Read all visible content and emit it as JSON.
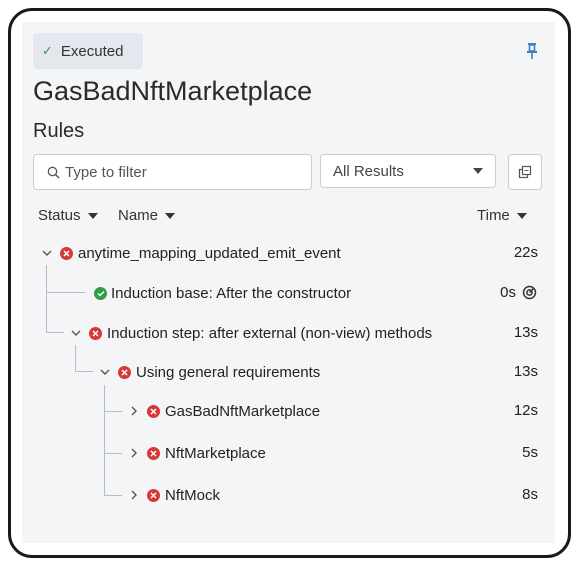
{
  "status_badge": {
    "icon": "check-icon",
    "label": "Executed"
  },
  "pin_icon": "pin-icon",
  "title": "GasBadNftMarketplace",
  "section_label": "Rules",
  "filter": {
    "placeholder": "Type to filter",
    "icon": "search-icon"
  },
  "results_select": {
    "selected": "All Results"
  },
  "columns": {
    "status": "Status",
    "name": "Name",
    "time": "Time"
  },
  "colors": {
    "error": "#d93838",
    "success": "#2f9e44",
    "accent_pin": "#3b82c4"
  },
  "rules": [
    {
      "name": "anytime_mapping_updated_emit_event",
      "status": "error",
      "time": "22s",
      "expanded": true
    },
    {
      "name": "Induction base: After the constructor",
      "status": "success",
      "time": "0s"
    },
    {
      "name": "Induction step: after external (non-view) methods",
      "status": "error",
      "time": "13s",
      "expanded": true
    },
    {
      "name": "Using general requirements",
      "status": "error",
      "time": "13s",
      "expanded": true
    },
    {
      "name": "GasBadNftMarketplace",
      "status": "error",
      "time": "12s",
      "expanded": false
    },
    {
      "name": "NftMarketplace",
      "status": "error",
      "time": "5s",
      "expanded": false
    },
    {
      "name": "NftMock",
      "status": "error",
      "time": "8s",
      "expanded": false
    }
  ]
}
